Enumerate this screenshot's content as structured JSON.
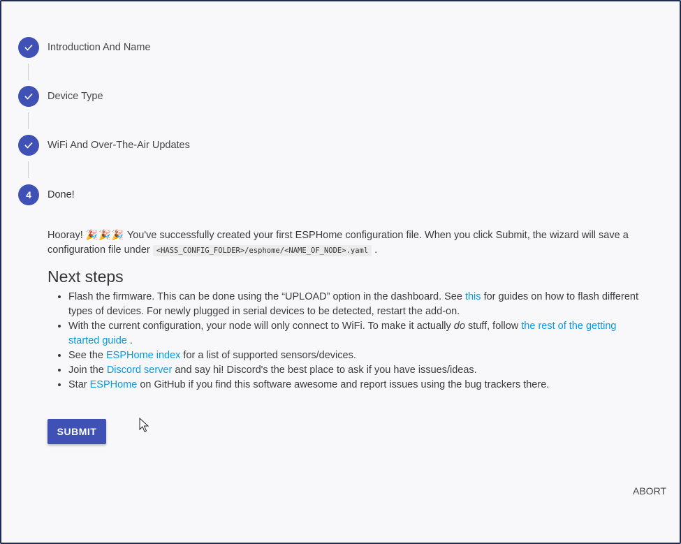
{
  "stepper": {
    "steps": [
      {
        "indicator": "check",
        "label": "Introduction And Name"
      },
      {
        "indicator": "check",
        "label": "Device Type"
      },
      {
        "indicator": "check",
        "label": "WiFi And Over-The-Air Updates"
      },
      {
        "indicator": "4",
        "label": "Done!"
      }
    ]
  },
  "done": {
    "intro_before": "Hooray!",
    "emoji": "🎉",
    "intro_after": " You've successfully created your first ESPHome configuration file. When you click Submit, the wizard will save a configuration file under ",
    "path_code": "<HASS_CONFIG_FOLDER>/esphome/<NAME_OF_NODE>.yaml",
    "intro_end": ".",
    "next_steps_title": "Next steps",
    "bullets": [
      {
        "before": "Flash the firmware. This can be done using the “UPLOAD” option in the dashboard. See ",
        "link": "this",
        "after": " for guides on how to flash different types of devices. For newly plugged in serial devices to be detected, restart the add-on."
      },
      {
        "before": "With the current configuration, your node will only connect to WiFi. To make it actually ",
        "em": "do",
        "mid": " stuff, follow ",
        "link": "the rest of the getting started guide",
        "after": " ."
      },
      {
        "before": "See the ",
        "link": "ESPHome index",
        "after": " for a list of supported sensors/devices."
      },
      {
        "before": "Join the ",
        "link": "Discord server",
        "after": " and say hi! Discord's the best place to ask if you have issues/ideas."
      },
      {
        "before": "Star ",
        "link": "ESPHome",
        "after": " on GitHub if you find this software awesome and report issues using the bug trackers there."
      }
    ]
  },
  "actions": {
    "submit_label": "SUBMIT",
    "abort_label": "ABORT"
  },
  "colors": {
    "primary": "#3f51b5",
    "link": "#039be5"
  }
}
